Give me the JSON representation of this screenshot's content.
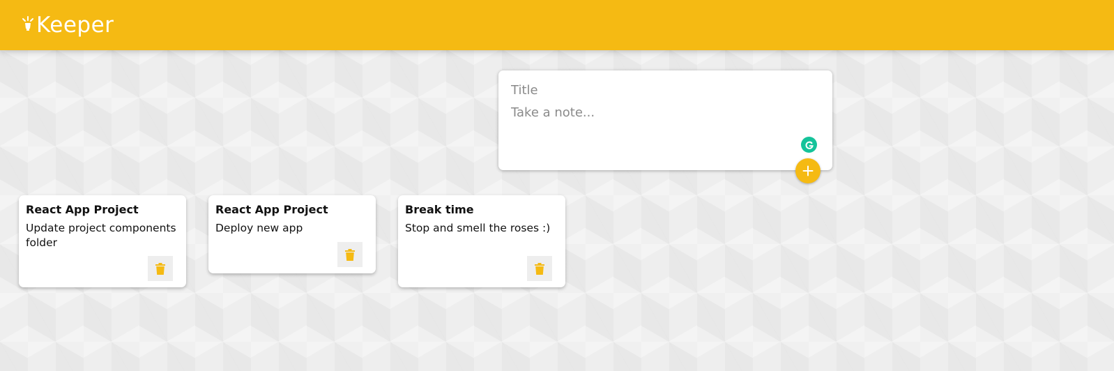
{
  "app": {
    "name": "Keeper",
    "icon": "lightbulb-icon",
    "brand_color": "#f5ba13"
  },
  "create_note": {
    "title_placeholder": "Title",
    "content_placeholder": "Take a note...",
    "title_value": "",
    "content_value": "",
    "grammarly_icon": "grammarly-icon",
    "add_icon": "plus-icon"
  },
  "notes": [
    {
      "title": "React App Project",
      "content": "Update project components folder",
      "delete_icon": "trash-icon"
    },
    {
      "title": "React App Project",
      "content": "Deploy new app",
      "delete_icon": "trash-icon"
    },
    {
      "title": "Break time",
      "content": "Stop and smell the roses :)",
      "delete_icon": "trash-icon"
    }
  ]
}
